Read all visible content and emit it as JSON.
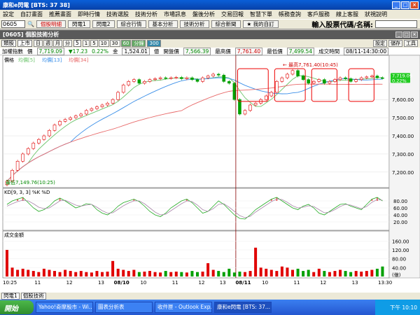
{
  "window": {
    "title": "康和e閃電 [BTS: 37 38]"
  },
  "menu": [
    "設定",
    "自訂畫面",
    "推薦畫面",
    "即時行情",
    "技術選股",
    "技術分析",
    "市場訊息",
    "盤後分析",
    "交易回報",
    "智慧下單",
    "帳務查詢",
    "客戶服務",
    "線上客服",
    "狀視說明"
  ],
  "toolbar": {
    "stock_code": "0605",
    "buttons": [
      "個股明細",
      "閃電1",
      "閃電2",
      "綜合行情",
      "基本分析",
      "技術分析",
      "綜合新聞"
    ],
    "favorites": "我的自訂",
    "search_label": "輸入股票代碼/名稱:"
  },
  "panel": {
    "title": "[0605] 個股技術分析"
  },
  "subbar": {
    "type": "類股",
    "market": "上市",
    "periods": [
      "日",
      "週",
      "月",
      "分"
    ],
    "interval": "5",
    "minutes": [
      "1",
      "5",
      "10",
      "30",
      "60"
    ],
    "active_minute": "60",
    "extra": "分鐘",
    "count": "300",
    "right_buttons": [
      "設定",
      "儲存",
      "工具"
    ]
  },
  "quote": {
    "name": "加權指數",
    "price_label": "價",
    "price": "7,719.09",
    "change": "▼17.23",
    "pct": "0.22%",
    "vol_label": "金",
    "volume": "1,524.01",
    "vol_unit": "億",
    "open_label": "開盤價",
    "open": "7,566.39",
    "high_label": "最高價",
    "high": "7,761.40",
    "low_label": "最低價",
    "low": "7,499.54",
    "time_label": "成交時間",
    "time": "08/11-14:30:00"
  },
  "chart_data": {
    "type": "line",
    "title": "加權指數",
    "price_axis": [
      "7,600.00",
      "7,500.00",
      "7,400.00",
      "7,300.00",
      "7,200.00"
    ],
    "indicators": [
      "價格",
      "均價[5]",
      "均價[13]",
      "均價[34]"
    ],
    "current_label": "7,719.09",
    "current_pct": "0.22%",
    "annotations": {
      "high": "← 最高7,761.40(10:45)",
      "low": "最低7,149.76(10:25)"
    },
    "close": [
      7150,
      7210,
      7260,
      7300,
      7330,
      7360,
      7380,
      7400,
      7430,
      7460,
      7480,
      7490,
      7500,
      7510,
      7520,
      7540,
      7550,
      7560,
      7570,
      7580,
      7600,
      7640,
      7680,
      7700,
      7710,
      7690,
      7700,
      7710,
      7715,
      7720,
      7718,
      7720,
      7722,
      7715,
      7720,
      7710,
      7700,
      7720,
      7730,
      7740,
      7735,
      7700,
      7690,
      7600,
      7520,
      7540,
      7570,
      7580,
      7600,
      7620,
      7640,
      7700,
      7720,
      7740,
      7760,
      7730,
      7710,
      7690,
      7700,
      7710,
      7690,
      7700,
      7710,
      7720,
      7715,
      7700,
      7710,
      7720,
      7725,
      7730,
      7720,
      7719
    ],
    "kd_label": "KD[9, 3, 3] %K %D",
    "kd_axis": [
      "80.00",
      "60.00",
      "40.00",
      "20.00"
    ],
    "k": [
      70,
      80,
      85,
      90,
      75,
      60,
      50,
      55,
      65,
      80,
      88,
      80,
      70,
      60,
      65,
      72,
      70,
      55,
      45,
      40,
      50,
      65,
      75,
      80,
      85,
      78,
      65,
      50,
      40,
      35,
      45,
      60,
      70,
      80,
      85,
      75,
      60,
      45,
      50,
      65,
      80,
      70,
      55,
      40,
      30,
      28,
      40,
      55,
      65,
      75,
      85,
      90,
      80,
      70,
      60,
      55,
      65,
      70,
      60,
      45,
      40,
      50,
      60,
      70,
      72,
      65,
      60,
      55,
      70,
      85,
      90,
      80
    ],
    "d": [
      65,
      72,
      78,
      82,
      80,
      72,
      62,
      58,
      60,
      70,
      80,
      82,
      75,
      68,
      65,
      68,
      70,
      62,
      52,
      45,
      46,
      56,
      66,
      74,
      80,
      80,
      72,
      60,
      48,
      40,
      42,
      52,
      62,
      72,
      80,
      78,
      68,
      55,
      50,
      58,
      70,
      72,
      62,
      50,
      38,
      32,
      36,
      48,
      58,
      68,
      78,
      85,
      84,
      76,
      66,
      60,
      62,
      66,
      64,
      55,
      46,
      48,
      55,
      64,
      70,
      68,
      63,
      58,
      64,
      76,
      84,
      82
    ],
    "vol_label": "成交金額",
    "vol_axis": [
      "160.00",
      "120.00",
      "80.00",
      "40.00"
    ],
    "vol_unit": "(億)",
    "volume": [
      120,
      40,
      30,
      35,
      30,
      25,
      20,
      35,
      30,
      25,
      20,
      30,
      25,
      20,
      25,
      20,
      18,
      25,
      20,
      22,
      70,
      35,
      30,
      25,
      30,
      20,
      22,
      25,
      20,
      18,
      25,
      20,
      22,
      20,
      18,
      25,
      20,
      22,
      60,
      30,
      25,
      20,
      35,
      18,
      22,
      20,
      25,
      130,
      40,
      35,
      30,
      25,
      45,
      40,
      30,
      35,
      25,
      30,
      20,
      35,
      25,
      20,
      25,
      30,
      25,
      20,
      25,
      22,
      25,
      30,
      35,
      45
    ],
    "x_labels": [
      "10:25",
      "11",
      "12",
      "13",
      "08/10",
      "10",
      "11",
      "12",
      "13",
      "08/11",
      "10",
      "11",
      "12",
      "13",
      "13:30"
    ],
    "colors": {
      "up": "#e00000",
      "down": "#00a000",
      "ma5": "#6bc46b",
      "ma13": "#3b8fe8",
      "ma34": "#e86a6a"
    }
  },
  "bottom_tabs": [
    "閃電1",
    "個股技術"
  ],
  "taskbar": {
    "start": "開始",
    "items": [
      "Yahoo!奇摩股市 - Wi...",
      "圖表分析表",
      "收件匣 - Outlook Exp...",
      "康和e閃電 [BTS: 37..."
    ],
    "clock": "下午 10:10"
  }
}
